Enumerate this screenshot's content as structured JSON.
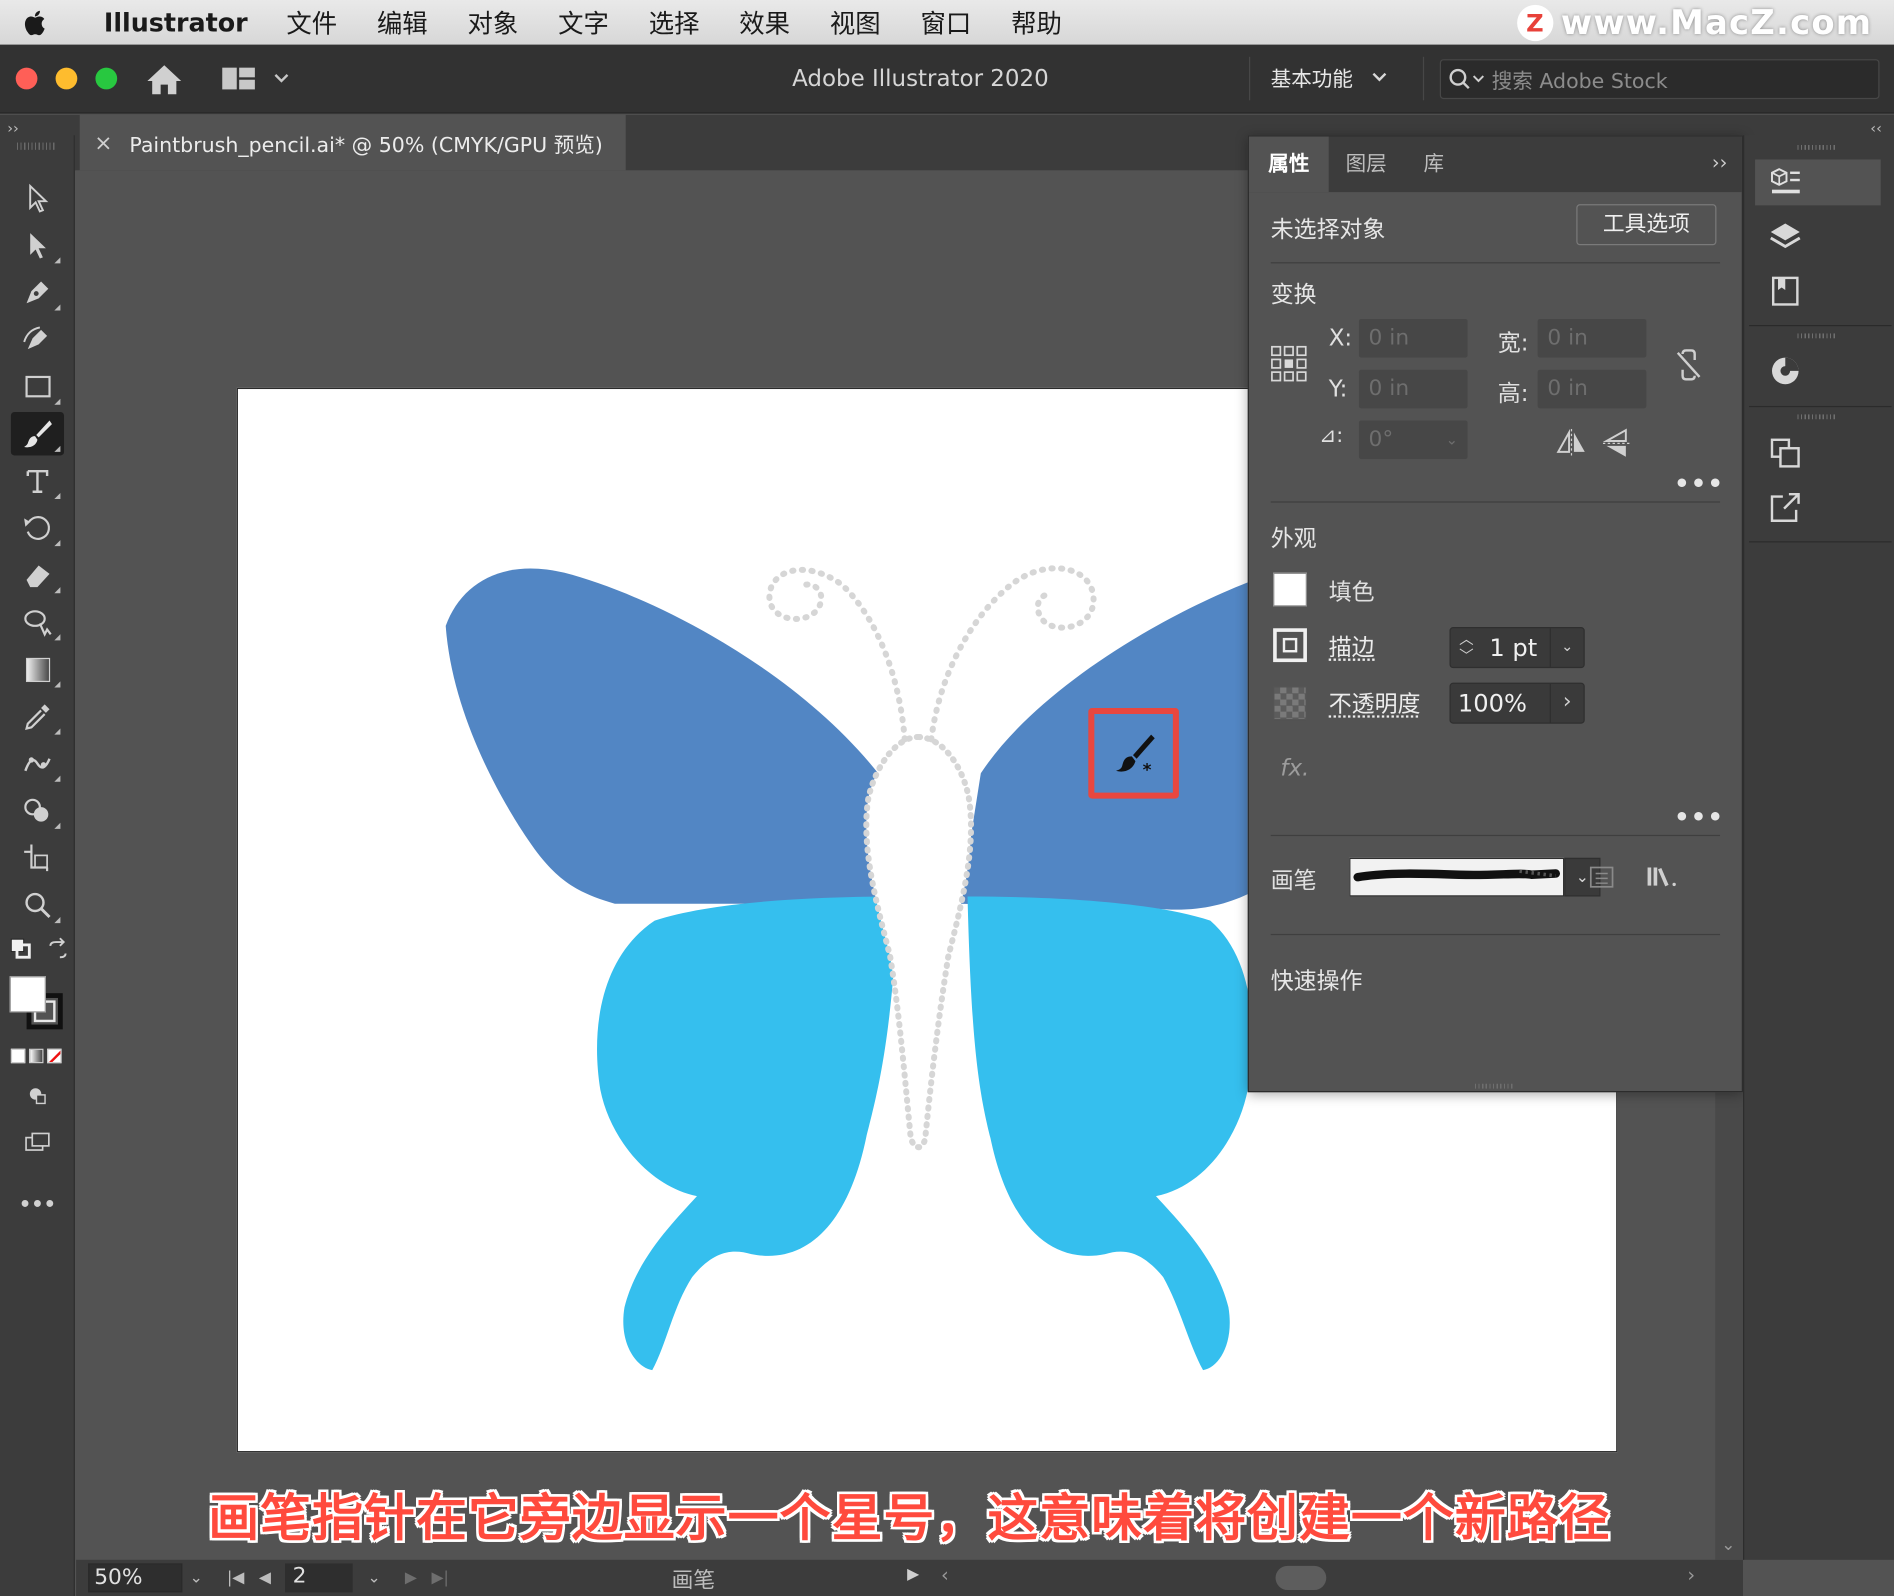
{
  "menubar": {
    "app_name": "Illustrator",
    "items": [
      "文件",
      "编辑",
      "对象",
      "文字",
      "选择",
      "效果",
      "视图",
      "窗口",
      "帮助"
    ],
    "watermark_text": "www.MacZ.com",
    "watermark_logo": "Z"
  },
  "titlebar": {
    "title": "Adobe Illustrator 2020",
    "workspace": "基本功能",
    "search_placeholder": "搜索 Adobe Stock"
  },
  "document_tab": {
    "close": "×",
    "title": "Paintbrush_pencil.ai* @ 50% (CMYK/GPU 预览)"
  },
  "toolbar": {
    "more": "•••",
    "tools": [
      {
        "name": "selection-tool",
        "icon": "arrow-outline-icon"
      },
      {
        "name": "direct-selection-tool",
        "icon": "arrow-solid-icon"
      },
      {
        "name": "pen-tool",
        "icon": "pen-icon"
      },
      {
        "name": "curvature-tool",
        "icon": "curvature-pen-icon"
      },
      {
        "name": "rectangle-tool",
        "icon": "rectangle-icon"
      },
      {
        "name": "paintbrush-tool",
        "icon": "paintbrush-icon",
        "active": true
      },
      {
        "name": "type-tool",
        "icon": "type-icon"
      },
      {
        "name": "rotate-tool",
        "icon": "rotate-icon"
      },
      {
        "name": "eraser-tool",
        "icon": "eraser-icon"
      },
      {
        "name": "lasso-tool",
        "icon": "lasso-icon"
      },
      {
        "name": "gradient-tool",
        "icon": "gradient-icon"
      },
      {
        "name": "eyedropper-tool",
        "icon": "eyedropper-icon"
      },
      {
        "name": "puppet-warp-tool",
        "icon": "puppet-warp-icon"
      },
      {
        "name": "shape-builder-tool",
        "icon": "shape-builder-icon"
      },
      {
        "name": "artboard-tool",
        "icon": "artboard-icon"
      },
      {
        "name": "zoom-tool",
        "icon": "zoom-icon"
      }
    ]
  },
  "canvas": {
    "caption": "画笔指针在它旁边显示一个星号，这意味着将创建一个新路径",
    "colors": {
      "upper_wing": "#5286c4",
      "lower_wing": "#35bfee",
      "body_outline": "#d6d6d6",
      "highlight_box": "#e8473f"
    }
  },
  "properties_panel": {
    "tabs": [
      "属性",
      "图层",
      "库"
    ],
    "active_tab": "属性",
    "no_selection": "未选择对象",
    "tool_options_button": "工具选项",
    "transform": {
      "title": "变换",
      "x_label": "X:",
      "y_label": "Y:",
      "w_label": "宽:",
      "h_label": "高:",
      "x_value": "0 in",
      "y_value": "0 in",
      "w_value": "0 in",
      "h_value": "0 in",
      "angle_label": "⊿:",
      "angle_value": "0°"
    },
    "appearance": {
      "title": "外观",
      "fill_label": "填色",
      "stroke_label": "描边",
      "stroke_value": "1 pt",
      "opacity_label": "不透明度",
      "opacity_value": "100%",
      "fx_label": "fx."
    },
    "brush": {
      "label": "画笔"
    },
    "quick_actions": {
      "title": "快速操作"
    },
    "more": "•••"
  },
  "statusbar": {
    "zoom": "50%",
    "page": "2",
    "current_tool": "画笔"
  }
}
